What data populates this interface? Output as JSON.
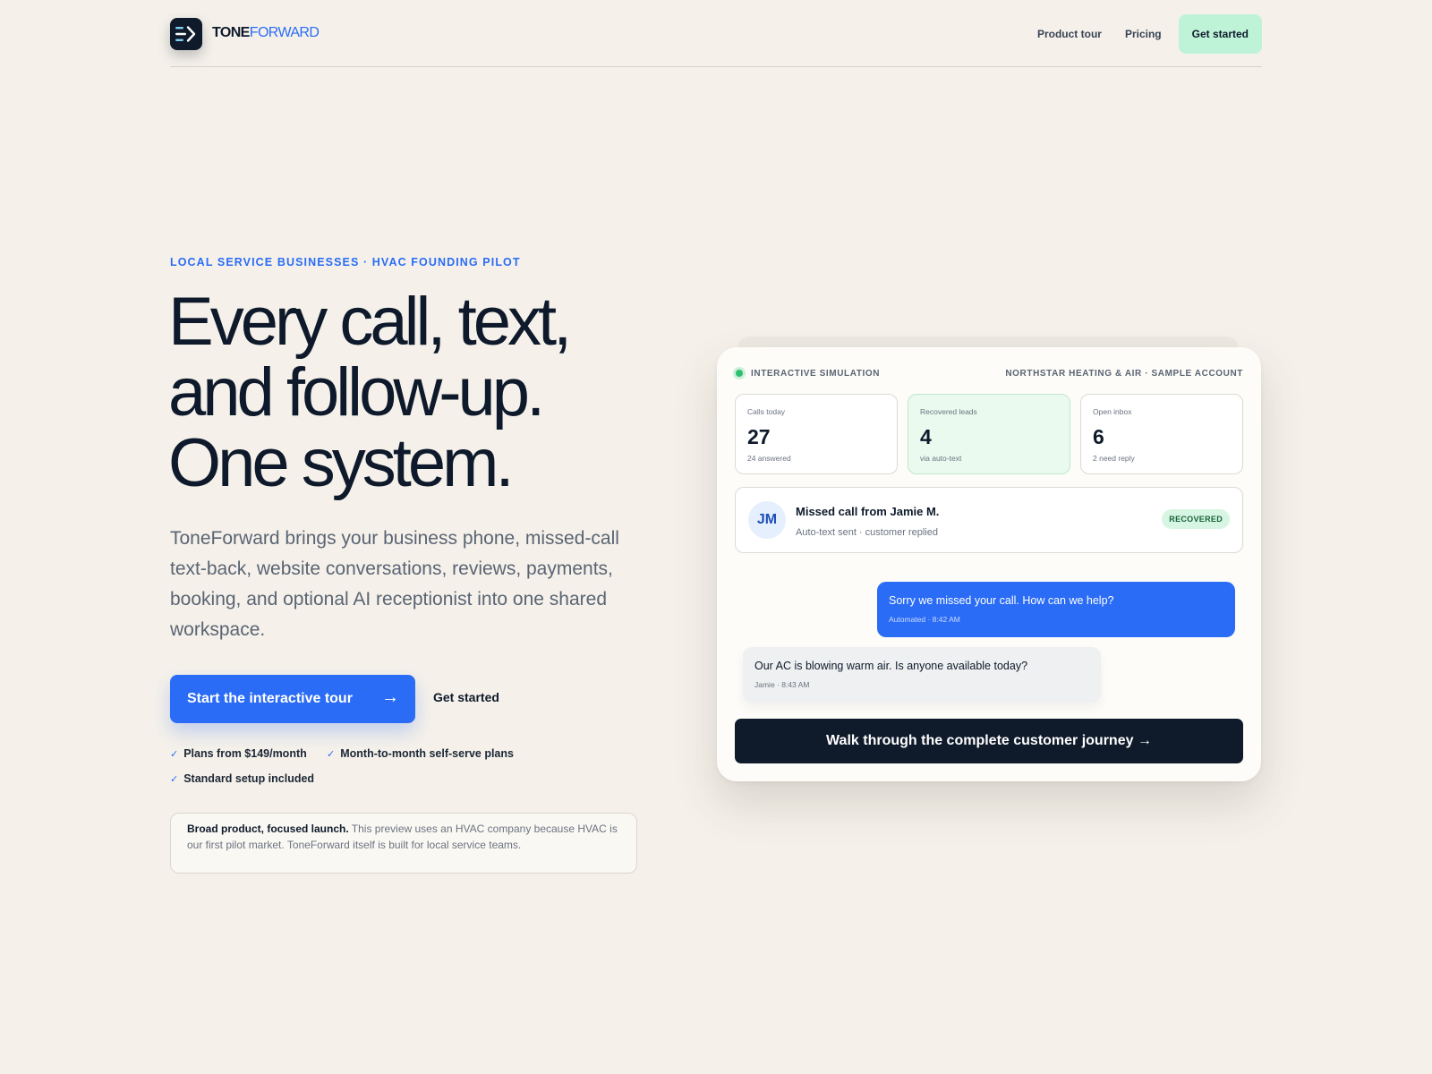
{
  "header": {
    "brand_first": "TONE",
    "brand_second": "FORWARD",
    "nav": {
      "product_tour": "Product tour",
      "pricing": "Pricing",
      "get_started": "Get started"
    }
  },
  "hero": {
    "eyebrow": "LOCAL SERVICE BUSINESSES · HVAC FOUNDING PILOT",
    "headline": [
      "Every call, text,",
      "and follow-up.",
      "One system."
    ],
    "lead": "ToneForward brings your business phone, missed-call text-back, website conversations, reviews, payments, booking, and optional AI receptionist into one shared workspace.",
    "primary_cta": "Start the interactive tour",
    "primary_cta_arrow": "→",
    "secondary_cta": "Get started",
    "perks": [
      "Plans from $149/month",
      "Month-to-month self-serve plans",
      "Standard setup included"
    ],
    "note_bold": "Broad product, focused launch.",
    "note_text": " This preview uses an HVAC company because HVAC is our first pilot market. ToneForward itself is built for local service teams."
  },
  "simulation": {
    "label": "INTERACTIVE SIMULATION",
    "account": "NORTHSTAR HEATING & AIR · SAMPLE ACCOUNT",
    "stats": [
      {
        "label": "Calls today",
        "value": "27",
        "sub": "24 answered"
      },
      {
        "label": "Recovered leads",
        "value": "4",
        "sub": "via auto-text"
      },
      {
        "label": "Open inbox",
        "value": "6",
        "sub": "2 need reply"
      }
    ],
    "missed": {
      "initials": "JM",
      "title": "Missed call from Jamie M.",
      "subtitle": "Auto-text sent · customer replied",
      "badge": "RECOVERED"
    },
    "messages": [
      {
        "text": "Sorry we missed your call. How can we help?",
        "meta": "Automated · 8:42 AM"
      },
      {
        "text": "Our AC is blowing warm air. Is anyone available today?",
        "meta": "Jamie · 8:43 AM"
      }
    ],
    "journey_cta": "Walk through the complete customer journey →"
  },
  "colors": {
    "background": "#f5f1ea",
    "accent": "#2a6cf5",
    "dark": "#0f1b2a",
    "mint": "#bff3d7"
  }
}
